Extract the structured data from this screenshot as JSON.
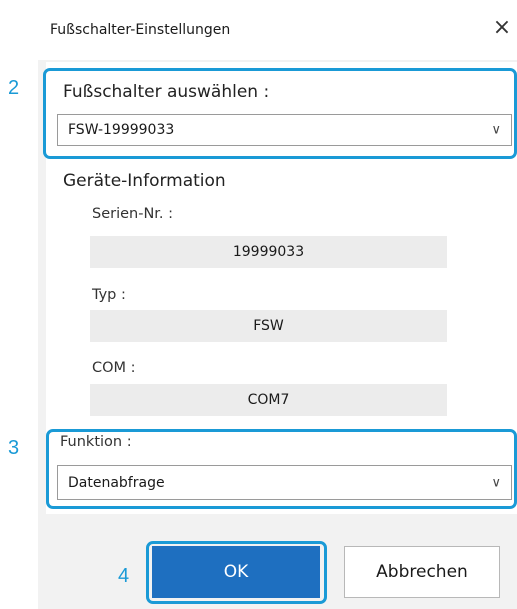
{
  "dialog": {
    "title": "Fußschalter-Einstellungen",
    "close_symbol": "×"
  },
  "footswitch_select": {
    "label": "Fußschalter auswählen :",
    "value": "FSW-19999033",
    "chevron": "∨"
  },
  "device_info": {
    "heading": "Geräte-Information",
    "serial_label": "Serien-Nr. :",
    "serial_value": "19999033",
    "type_label": "Typ :",
    "type_value": "FSW",
    "com_label": "COM :",
    "com_value": "COM7"
  },
  "function_select": {
    "label": "Funktion :",
    "value": "Datenabfrage",
    "chevron": "∨"
  },
  "buttons": {
    "ok": "OK",
    "cancel": "Abbrechen"
  },
  "callouts": {
    "n2": "2",
    "n3": "3",
    "n4": "4"
  },
  "colors": {
    "highlight": "#1a9ad6",
    "ok_button": "#1e6fc0"
  }
}
